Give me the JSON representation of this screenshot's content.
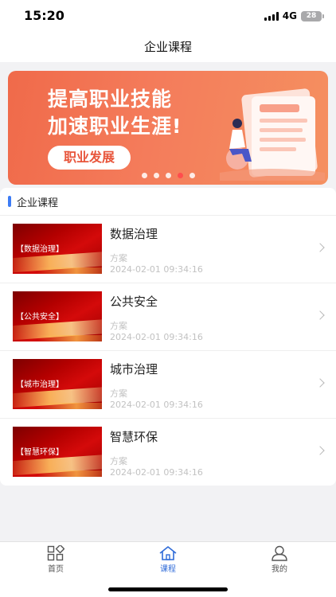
{
  "status_bar": {
    "time": "15:20",
    "network": "4G",
    "battery": "28"
  },
  "nav": {
    "title": "企业课程"
  },
  "banner": {
    "line1": "提高职业技能",
    "line2": "加速职业生涯!",
    "button_label": "职业发展",
    "dot_count": 5,
    "active_dot": 3
  },
  "section": {
    "title": "企业课程"
  },
  "courses": [
    {
      "thumb_tag": "【数据治理】",
      "title": "数据治理",
      "category": "方案",
      "date": "2024-02-01 09:34:16"
    },
    {
      "thumb_tag": "【公共安全】",
      "title": "公共安全",
      "category": "方案",
      "date": "2024-02-01 09:34:16"
    },
    {
      "thumb_tag": "【城市治理】",
      "title": "城市治理",
      "category": "方案",
      "date": "2024-02-01 09:34:16"
    },
    {
      "thumb_tag": "【智慧环保】",
      "title": "智慧环保",
      "category": "方案",
      "date": "2024-02-01 09:34:16"
    }
  ],
  "tabs": [
    {
      "label": "首页",
      "icon": "grid-icon",
      "active": false
    },
    {
      "label": "课程",
      "icon": "house-icon",
      "active": true
    },
    {
      "label": "我的",
      "icon": "person-icon",
      "active": false
    }
  ],
  "colors": {
    "accent": "#2f6bd8",
    "banner": "#f47c5b",
    "section_bar": "#3d7cf5"
  }
}
